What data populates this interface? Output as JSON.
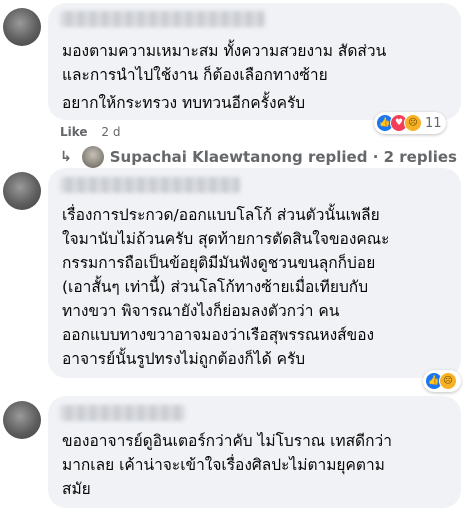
{
  "comments": [
    {
      "lines": [
        "มองตามความเหมาะสม ทั้งความสวยงาม สัดส่วน",
        "และการนำไปใช้งาน ก็ต้องเลือกทางซ้าย",
        "อยากให้กระทรวง ทบทวนอีกครั้งครับ"
      ],
      "like_label": "Like",
      "time": "2 d",
      "reaction_count": "11",
      "reaction_icons": [
        "like-icon",
        "love-icon",
        "sad-icon"
      ],
      "reply_arrow_icon": "reply-arrow-icon",
      "replies_text": "Supachai Klaewtanong replied · 2 replies"
    },
    {
      "lines": [
        "เรื่องการประกวด/ออกแบบโลโก้ ส่วนตัวนั้นเพลีย",
        "ใจมานับไม่ถ้วนครับ สุดท้ายการตัดสินใจของคณะ",
        "กรรมการถือเป็นข้อยุติมีมันฟังดูชวนขนลุกก็บ่อย",
        "(เอาสั้นๆ เท่านี้) ส่วนโลโก้ทางซ้ายเมื่อเทียบกับ",
        "ทางขวา พิจารณายังไงก็ย่อมลงตัวกว่า คน",
        "ออกแบบทางขวาอาจมองว่าเรือสุพรรณหงส์ของ",
        "อาจารย์นั้นรูปทรงไม่ถูกต้องก็ได้ ครับ"
      ],
      "reaction_icons": [
        "like-icon",
        "sad-icon"
      ]
    },
    {
      "lines": [
        "ของอาจารย์ดูอินเตอร์กว่าคับ ไม่โบราณ เทสดีกว่า",
        "มากเลย เค้าน่าจะเข้าใจเรื่องศิลปะไม่ตามยุคตาม",
        "สมัย"
      ]
    }
  ]
}
